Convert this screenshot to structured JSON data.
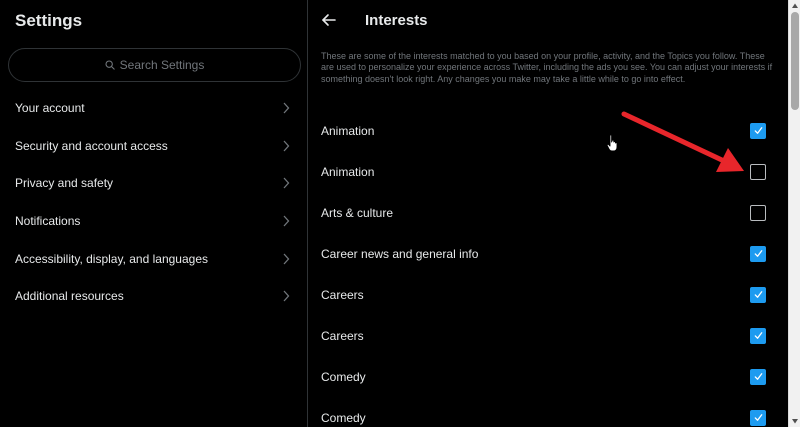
{
  "settings": {
    "title": "Settings",
    "search_placeholder": "Search Settings",
    "nav": [
      {
        "label": "Your account"
      },
      {
        "label": "Security and account access"
      },
      {
        "label": "Privacy and safety"
      },
      {
        "label": "Notifications"
      },
      {
        "label": "Accessibility, display, and languages"
      },
      {
        "label": "Additional resources"
      }
    ]
  },
  "interests": {
    "title": "Interests",
    "description": "These are some of the interests matched to you based on your profile, activity, and the Topics you follow. These are used to personalize your experience across Twitter, including the ads you see. You can adjust your interests if something doesn't look right. Any changes you make may take a little while to go into effect.",
    "items": [
      {
        "label": "Animation",
        "checked": true
      },
      {
        "label": "Animation",
        "checked": false
      },
      {
        "label": "Arts & culture",
        "checked": false
      },
      {
        "label": "Career news and general info",
        "checked": true
      },
      {
        "label": "Careers",
        "checked": true
      },
      {
        "label": "Careers",
        "checked": true
      },
      {
        "label": "Comedy",
        "checked": true
      },
      {
        "label": "Comedy",
        "checked": true
      }
    ]
  },
  "icons": {
    "back": "arrow-left-icon",
    "search": "search-icon",
    "chevron": "chevron-right-icon",
    "checkbox": "checkmark-icon"
  },
  "colors": {
    "background": "#000000",
    "accent": "#1d9bf0",
    "text": "#e7e9ea",
    "muted": "#71767b",
    "annotation_arrow": "#e8262b"
  }
}
